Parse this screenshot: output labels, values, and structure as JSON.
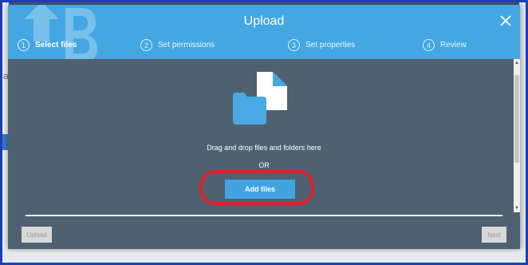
{
  "dialog": {
    "title": "Upload",
    "close_icon": "close-icon"
  },
  "steps": [
    {
      "number": "1",
      "label": "Select files",
      "active": true
    },
    {
      "number": "2",
      "label": "Set permissions",
      "active": false
    },
    {
      "number": "3",
      "label": "Set properties",
      "active": false
    },
    {
      "number": "4",
      "label": "Review",
      "active": false
    }
  ],
  "dropzone": {
    "icon": "files-folder-icon",
    "instruction": "Drag and drop files and folders here",
    "or_text": "OR",
    "add_files_label": "Add files"
  },
  "footer": {
    "upload_label": "Upload",
    "next_label": "Next"
  },
  "background": {
    "letter": "a"
  },
  "colors": {
    "header": "#44a7e2",
    "body": "#4f6170",
    "button": "#41a3e0",
    "highlight": "#e0202a",
    "frame": "#1d3fbd"
  }
}
